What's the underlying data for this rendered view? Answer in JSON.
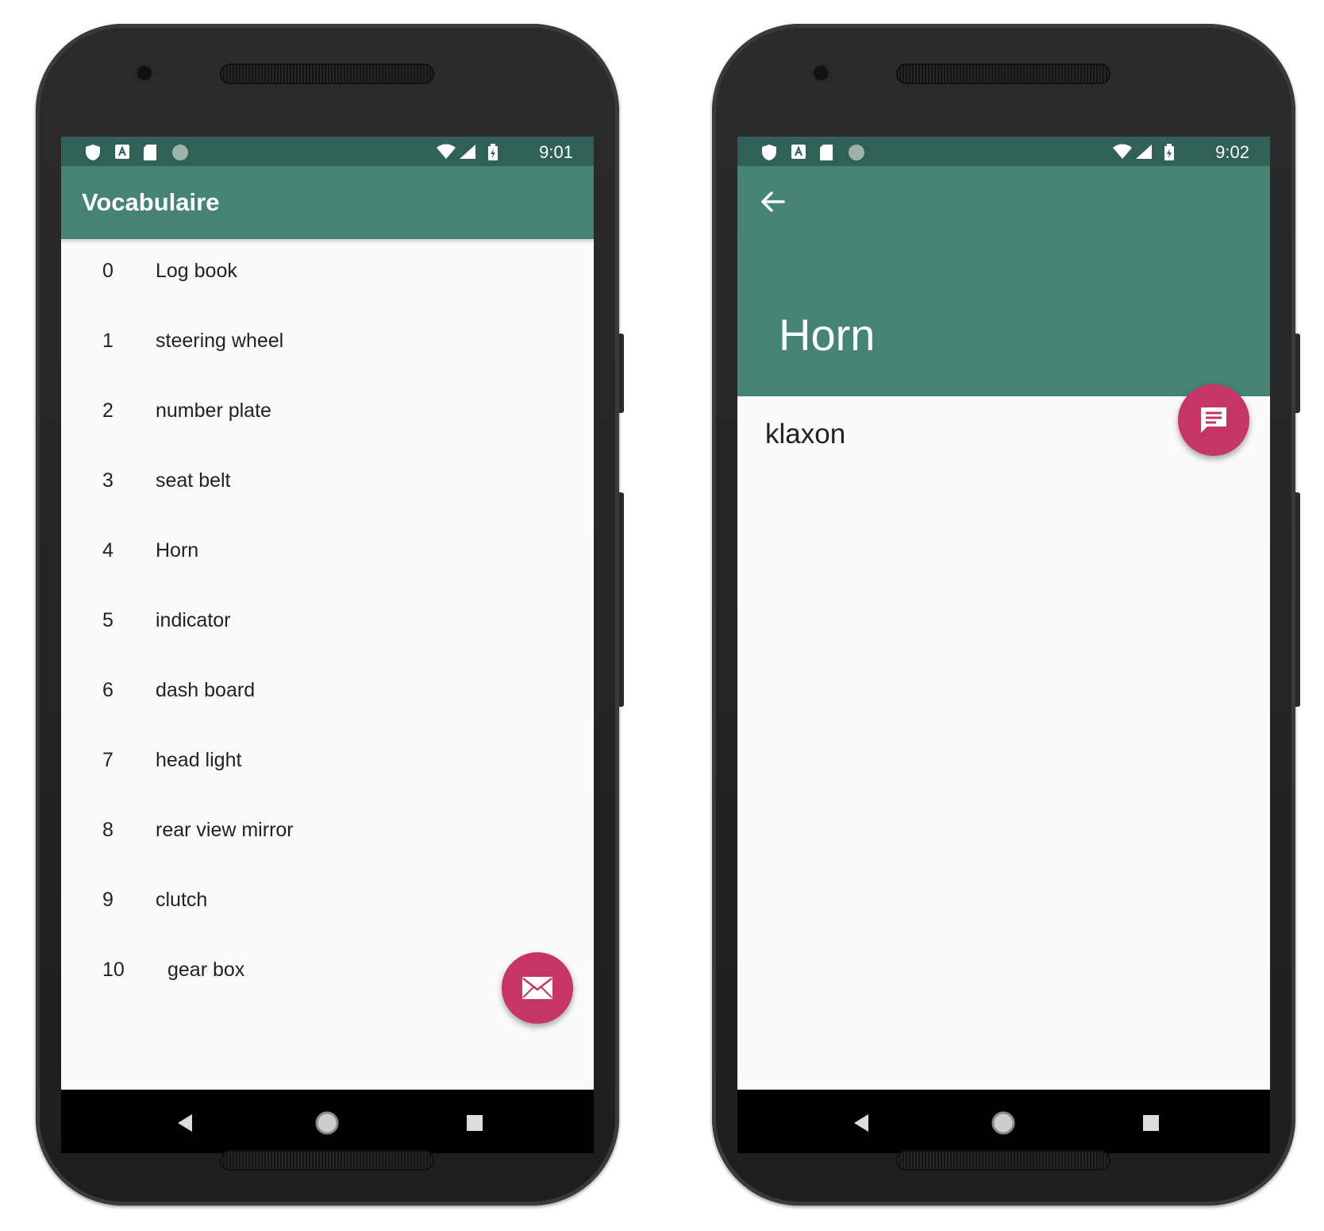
{
  "left_screen": {
    "status_time": "9:01",
    "app_title": "Vocabulaire",
    "items": [
      {
        "num": "0",
        "word": "Log book"
      },
      {
        "num": "1",
        "word": "steering wheel"
      },
      {
        "num": "2",
        "word": "number plate"
      },
      {
        "num": "3",
        "word": "seat belt"
      },
      {
        "num": "4",
        "word": "Horn"
      },
      {
        "num": "5",
        "word": "indicator"
      },
      {
        "num": "6",
        "word": "dash board"
      },
      {
        "num": "7",
        "word": "head light"
      },
      {
        "num": "8",
        "word": "rear view mirror"
      },
      {
        "num": "9",
        "word": "clutch"
      },
      {
        "num": "10",
        "word": "gear box"
      }
    ],
    "fab_icon": "mail-icon"
  },
  "right_screen": {
    "status_time": "9:02",
    "detail_title": "Horn",
    "detail_body": "klaxon",
    "fab_icon": "chat-icon"
  },
  "colors": {
    "primary": "#458375",
    "primary_dark": "#2f6156",
    "accent": "#c73566"
  }
}
